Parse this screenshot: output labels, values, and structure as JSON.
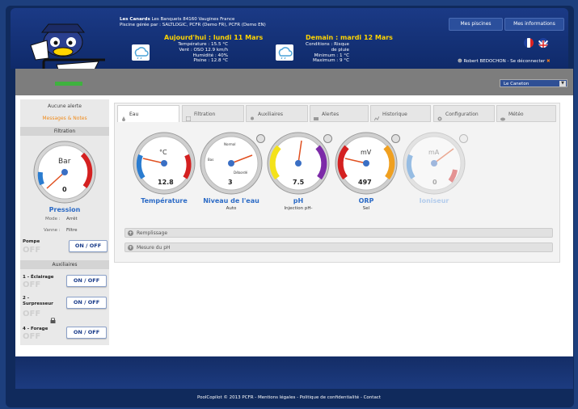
{
  "header": {
    "site_name": "Les Canards",
    "site_address": "Les Banquets 84160 Vaugines France",
    "managed_by": "Piscine gérée par : SALTLOGIC, PCFR (Demo FR), PCFR (Demo EN)",
    "today": {
      "title": "Aujourd'hui : lundi 11 Mars",
      "lines": [
        "Température : 15.5 °C",
        "Vent : OSO 12.9 km/h",
        "Humidité : 40%",
        "Pisine : 12.8 °C"
      ]
    },
    "tomorrow": {
      "title": "Demain : mardi 12 Mars",
      "lines": [
        "Conditions : Risque de pluie",
        "Minimum : 1 °C",
        "Maximum : 9 °C"
      ]
    },
    "buttons": {
      "pools": "Mes piscines",
      "info": "Mes informations"
    },
    "user_line": "Robert BEDOCHON - Se déconnecter",
    "pool_select": "Le Caneton"
  },
  "sidebar": {
    "alerts": "Aucune alerte",
    "messages": "Messages & Notes",
    "filtration": "Filtration",
    "gauge": {
      "unit": "Bar",
      "value": "0"
    },
    "pressure": "Pression",
    "mode": "Mode :",
    "mode_val": "Arrêt",
    "valve": "Vanne :",
    "valve_val": "Filtre",
    "pump": "Pompe",
    "onoff": "ON / OFF",
    "off": "OFF",
    "aux_title": "Auxiliaires",
    "aux": [
      {
        "label": "1 - Éclairage"
      },
      {
        "label": "2 - Surpresseur"
      },
      {
        "label": "4 - Forage"
      }
    ]
  },
  "tabs": [
    "Eau",
    "Filtration",
    "Auxiliaires",
    "Alertes",
    "Historique",
    "Configuration",
    "Météo"
  ],
  "gauges": [
    {
      "label": "Température",
      "sub": "",
      "unit": "°C",
      "value": "12.8"
    },
    {
      "label": "Niveau de l'eau",
      "sub": "Auto",
      "unit": "",
      "value": "3",
      "top": "Normal",
      "left": "Bas",
      "bottom": "Débordé"
    },
    {
      "label": "pH",
      "sub": "Injection pH-",
      "unit": "",
      "value": "7.5"
    },
    {
      "label": "ORP",
      "sub": "Sel",
      "unit": "mV",
      "value": "497"
    },
    {
      "label": "Ioniseur",
      "sub": "",
      "unit": "mA",
      "value": "0"
    }
  ],
  "accordions": [
    "Remplissage",
    "Mesure du pH"
  ],
  "footer": "PoolCopilot © 2013 PCFR - Mentions légales - Politique de confidentialité - Contact"
}
